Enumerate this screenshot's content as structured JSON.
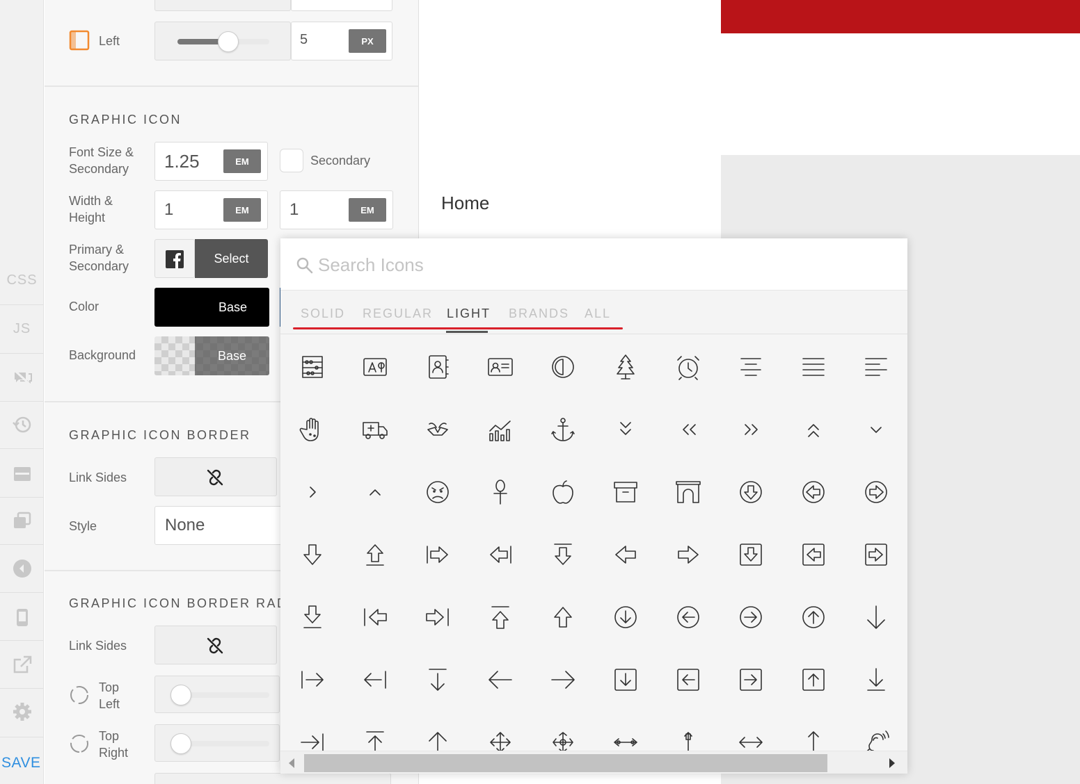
{
  "rail": {
    "css_label": "CSS",
    "js_label": "JS",
    "save_label": "SAVE"
  },
  "panel": {
    "border_left_label": "Left",
    "border_left_value": "5",
    "border_left_unit": "PX",
    "border_left_slider_fraction": 0.45,
    "graphic_icon": {
      "title": "GRAPHIC ICON",
      "font_size_label": "Font Size & Secondary",
      "font_size_value": "1.25",
      "font_size_unit": "EM",
      "secondary_label": "Secondary",
      "width_height_label": "Width & Height",
      "width_value": "1",
      "width_unit": "EM",
      "height_value": "1",
      "height_unit": "EM",
      "primary_secondary_label": "Primary & Secondary",
      "select_label": "Select",
      "color_label": "Color",
      "color_value_label": "Base",
      "background_label": "Background",
      "background_value_label": "Base"
    },
    "graphic_icon_border": {
      "title": "GRAPHIC ICON BORDER",
      "link_sides_label": "Link Sides",
      "style_label": "Style",
      "style_value": "None"
    },
    "graphic_icon_border_radius": {
      "title": "GRAPHIC ICON BORDER RADIUS",
      "link_sides_label": "Link Sides",
      "top_left_label": "Top Left",
      "top_right_label": "Top Right"
    }
  },
  "preview": {
    "accent_color": "#b91418",
    "home_label": "Home"
  },
  "picker": {
    "search_placeholder": "Search Icons",
    "tabs": [
      "SOLID",
      "REGULAR",
      "LIGHT",
      "BRANDS",
      "ALL"
    ],
    "active_tab": "LIGHT",
    "icons": [
      [
        "abacus-icon",
        "ad-icon",
        "address-book-icon",
        "address-card-icon",
        "adjust-icon",
        "tree-icon",
        "alarm-clock-icon",
        "align-center-icon",
        "align-justify-icon",
        "align-left-icon"
      ],
      [
        "allergies-icon",
        "ambulance-icon",
        "ankh-brand-icon",
        "analytics-icon",
        "anchor-icon",
        "angle-double-down-icon",
        "angle-double-left-icon",
        "angle-double-right-icon",
        "angle-double-up-icon",
        "angle-down-icon"
      ],
      [
        "angle-right-icon",
        "angle-up-icon",
        "angry-icon",
        "ankh-icon",
        "apple-alt-icon",
        "archive-icon",
        "archway-icon",
        "arrow-alt-circle-down-icon",
        "arrow-alt-circle-left-icon",
        "arrow-alt-circle-right-icon"
      ],
      [
        "arrow-alt-down-icon",
        "arrow-alt-from-bottom-icon",
        "arrow-alt-from-left-icon",
        "arrow-alt-from-right-icon",
        "arrow-alt-from-top-icon",
        "arrow-alt-left-icon",
        "arrow-alt-right-icon",
        "arrow-alt-square-down-icon",
        "arrow-alt-square-left-icon",
        "arrow-alt-square-right-icon"
      ],
      [
        "arrow-alt-to-bottom-icon",
        "arrow-alt-to-left-icon",
        "arrow-alt-to-right-icon",
        "arrow-alt-to-top-icon",
        "arrow-alt-up-icon",
        "arrow-circle-down-icon",
        "arrow-circle-left-icon",
        "arrow-circle-right-icon",
        "arrow-circle-up-icon",
        "arrow-down-icon"
      ],
      [
        "arrow-from-left-icon",
        "arrow-from-right-icon",
        "arrow-from-top-icon",
        "arrow-left-icon",
        "arrow-right-icon",
        "arrow-square-down-icon",
        "arrow-square-left-icon",
        "arrow-square-right-icon",
        "arrow-square-up-icon",
        "arrow-to-bottom-icon"
      ],
      [
        "arrow-to-right-icon",
        "arrow-to-top-icon",
        "arrow-up-icon",
        "arrows-icon",
        "arrows-alt-icon",
        "arrows-alt-h-icon",
        "arrows-alt-v-icon",
        "arrows-h-icon",
        "arrow-up-thin-icon",
        "assistive-listening-icon"
      ]
    ]
  }
}
